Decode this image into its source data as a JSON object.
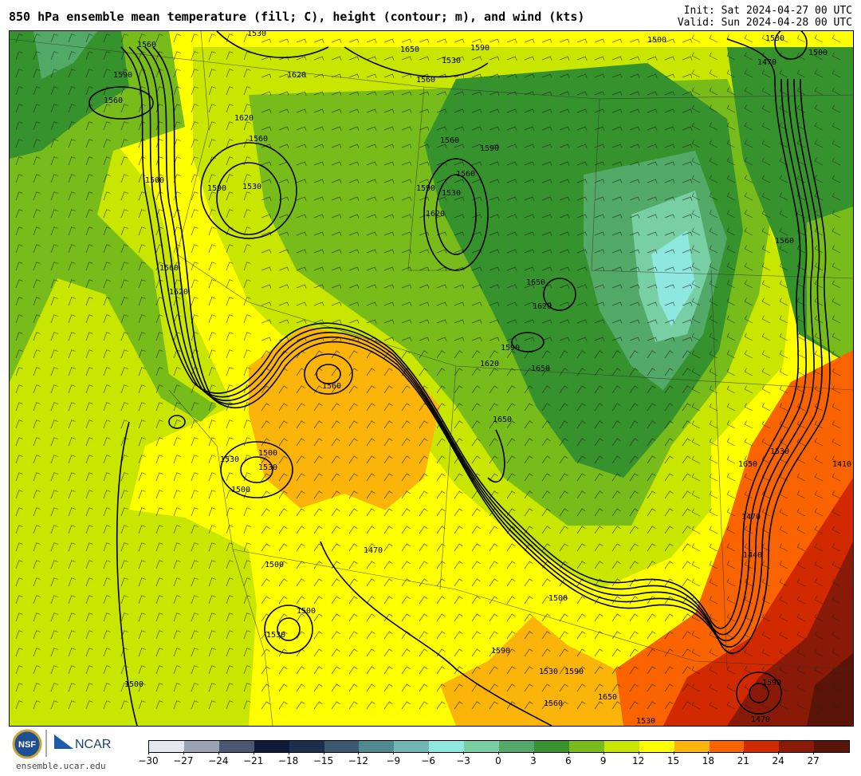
{
  "header": {
    "title": "850 hPa ensemble mean temperature (fill; C), height (contour; m), and wind (kts)",
    "init": "Init: Sat 2024-04-27 00 UTC",
    "valid": "Valid: Sun 2024-04-28 00 UTC"
  },
  "footer": {
    "site": "ensemble.ucar.edu",
    "logo_nsf": "NSF",
    "logo_ncar": "NCAR"
  },
  "colorbar": {
    "ticks": [
      "−30",
      "−27",
      "−24",
      "−21",
      "−18",
      "−15",
      "−12",
      "−9",
      "−6",
      "−3",
      "0",
      "3",
      "6",
      "9",
      "12",
      "15",
      "18",
      "21",
      "24",
      "27"
    ],
    "colors": [
      "#e4e8ee",
      "#9aa3b5",
      "#4b5670",
      "#0d1a38",
      "#1c2e4e",
      "#3b5970",
      "#4f8a90",
      "#70b6b6",
      "#8fe8e0",
      "#78cfa4",
      "#53aa68",
      "#36922c",
      "#78bc1c",
      "#c8e600",
      "#ffff00",
      "#fab40a",
      "#fa6400",
      "#d22a00",
      "#8a1a08",
      "#5a1408"
    ]
  },
  "map": {
    "contour_labels": [
      {
        "text": "1590"
      },
      {
        "text": "1530"
      },
      {
        "text": "1560"
      },
      {
        "text": "1650"
      },
      {
        "text": "1530"
      },
      {
        "text": "1560"
      },
      {
        "text": "1590"
      },
      {
        "text": "1560"
      },
      {
        "text": "1620"
      },
      {
        "text": "1500"
      },
      {
        "text": "1590"
      },
      {
        "text": "1530"
      },
      {
        "text": "1470"
      },
      {
        "text": "1500"
      },
      {
        "text": "1620"
      },
      {
        "text": "1560"
      },
      {
        "text": "1530"
      },
      {
        "text": "1590"
      },
      {
        "text": "1560"
      },
      {
        "text": "1500"
      },
      {
        "text": "1590"
      },
      {
        "text": "1620"
      },
      {
        "text": "1530"
      },
      {
        "text": "1560"
      },
      {
        "text": "1620"
      },
      {
        "text": "1560"
      },
      {
        "text": "1650"
      },
      {
        "text": "1620"
      },
      {
        "text": "1590"
      },
      {
        "text": "1650"
      },
      {
        "text": "1620"
      },
      {
        "text": "1650"
      },
      {
        "text": "1560"
      },
      {
        "text": "1530"
      },
      {
        "text": "1500"
      },
      {
        "text": "1530"
      },
      {
        "text": "1500"
      },
      {
        "text": "1470"
      },
      {
        "text": "1500"
      },
      {
        "text": "1500"
      },
      {
        "text": "1530"
      },
      {
        "text": "1500"
      },
      {
        "text": "1590"
      },
      {
        "text": "1530"
      },
      {
        "text": "1590"
      },
      {
        "text": "1560"
      },
      {
        "text": "1650"
      },
      {
        "text": "1530"
      },
      {
        "text": "1470"
      },
      {
        "text": "1440"
      },
      {
        "text": "1650"
      },
      {
        "text": "1410"
      },
      {
        "text": "1500"
      },
      {
        "text": "1590"
      },
      {
        "text": "1470"
      },
      {
        "text": "1530"
      },
      {
        "text": "1560"
      }
    ]
  }
}
